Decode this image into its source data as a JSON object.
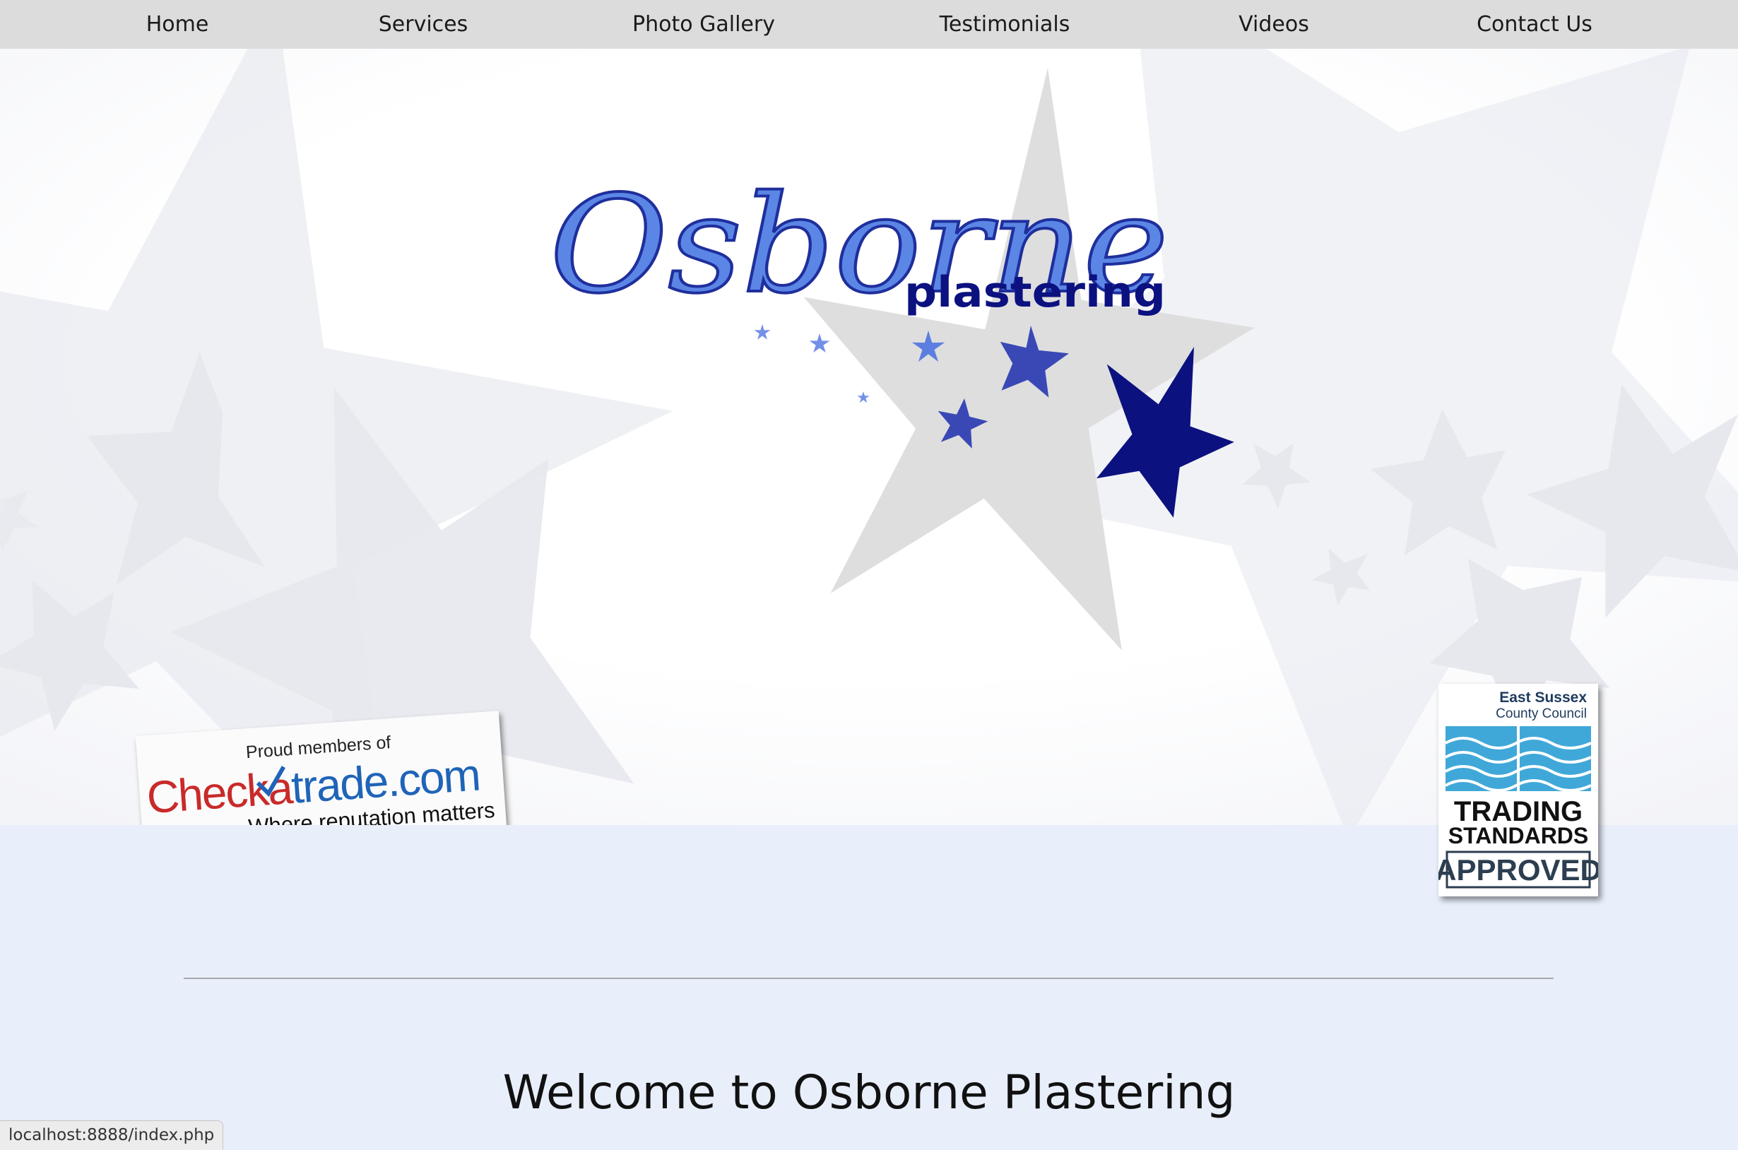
{
  "nav": {
    "items": [
      {
        "label": "Home"
      },
      {
        "label": "Services"
      },
      {
        "label": "Photo Gallery"
      },
      {
        "label": "Testimonials"
      },
      {
        "label": "Videos"
      },
      {
        "label": "Contact Us"
      }
    ]
  },
  "logo": {
    "main": "Osborne",
    "sub": "plastering"
  },
  "badges": {
    "checkatrade": {
      "top": "Proud members of",
      "brand_check": "Check",
      "brand_a": "a",
      "brand_trade": "trade",
      "brand_com": ".com",
      "tagline": "Where reputation matters"
    },
    "trading_standards": {
      "council_line1": "East Sussex",
      "council_line2": "County Council",
      "line1": "TRADING",
      "line2": "STANDARDS",
      "line3": "APPROVED"
    }
  },
  "main": {
    "welcome": "Welcome to Osborne Plastering"
  },
  "status_url": "localhost:8888/index.php",
  "colors": {
    "nav_bg": "#dcdcdc",
    "page_bg": "#e8effb",
    "logo_blue": "#5b86e6",
    "navy": "#0c1180",
    "star_mid": "#3a48b6",
    "checkatrade_red": "#c92a2a",
    "checkatrade_blue": "#1f64b8",
    "trading_blue": "#40a8d8"
  },
  "icons": [
    "star-icon",
    "waves-icon"
  ]
}
